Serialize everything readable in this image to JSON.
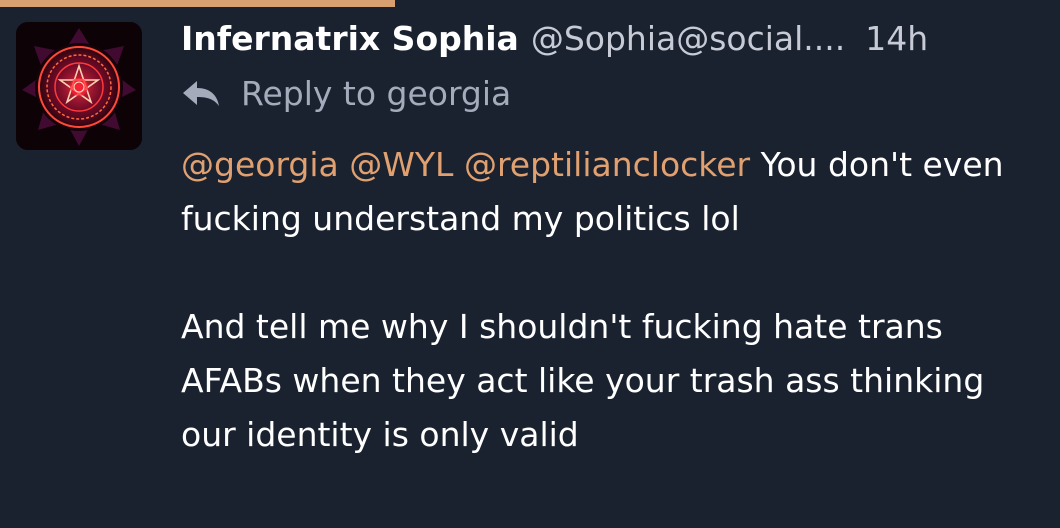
{
  "post": {
    "author": {
      "display_name": "Infernatrix Sophia",
      "handle": "@Sophia@social....",
      "avatar_icon": "pentagram-sigil-icon"
    },
    "timestamp": "14h",
    "reply_to": {
      "icon": "reply-arrow-icon",
      "text": "Reply to georgia"
    },
    "mentions": [
      "@georgia",
      "@WYL",
      "@reptilianclocker"
    ],
    "paragraph_1_text": "You don't even fucking understand my politics lol",
    "paragraph_2_text": "And tell me why I shouldn't fucking hate trans AFABs when they act like your trash ass thinking our identity is only valid"
  },
  "colors": {
    "background": "#1a2230",
    "accent": "#d8a070",
    "mention": "#e0a070",
    "text": "#ffffff",
    "muted_text": "#a4abba"
  }
}
